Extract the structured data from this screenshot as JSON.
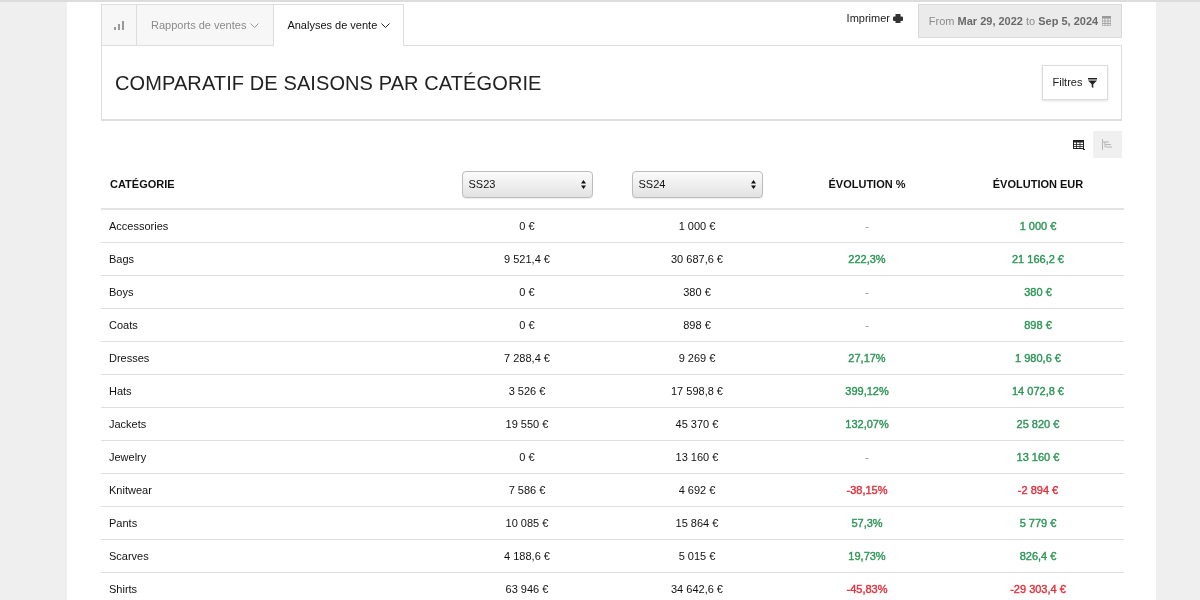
{
  "tabs": [
    {
      "kind": "icon",
      "selected": false
    },
    {
      "kind": "dropdown",
      "label": "Rapports de ventes",
      "selected": false
    },
    {
      "kind": "dropdown",
      "label": "Analyses de vente",
      "selected": true
    }
  ],
  "print": {
    "label": "Imprimer"
  },
  "date_range": {
    "text": "From **Mar 29, 2022** to **Sep 5, 2024**"
  },
  "panel": {
    "title": "COMPARATIF DE SAISONS PAR CATÉGORIE",
    "filter_button": "Filtres"
  },
  "view_toggles": [
    {
      "kind": "table",
      "selected": true
    },
    {
      "kind": "tree",
      "selected": false
    }
  ],
  "table": {
    "columns": [
      {
        "kind": "text",
        "label": "CATÉGORIE"
      },
      {
        "kind": "select",
        "value": "SS23"
      },
      {
        "kind": "select",
        "value": "SS24"
      },
      {
        "kind": "text",
        "label": "ÉVOLUTION %"
      },
      {
        "kind": "text",
        "label": "ÉVOLUTION EUR"
      }
    ],
    "rows": [
      {
        "category": "Accessories",
        "season_1": "0 €",
        "season_2": "1 000 €",
        "evolution_pct": {
          "kind": "empty",
          "text": "-"
        },
        "evolution_eur": {
          "kind": "value",
          "text": "1 000 €",
          "color": "#2f9657"
        }
      },
      {
        "category": "Bags",
        "season_1": "9 521,4 €",
        "season_2": "30 687,6 €",
        "evolution_pct": {
          "kind": "value",
          "text": "222,3%",
          "color": "#2f9657"
        },
        "evolution_eur": {
          "kind": "value",
          "text": "21 166,2 €",
          "color": "#2f9657"
        }
      },
      {
        "category": "Boys",
        "season_1": "0 €",
        "season_2": "380 €",
        "evolution_pct": {
          "kind": "empty",
          "text": "-"
        },
        "evolution_eur": {
          "kind": "value",
          "text": "380 €",
          "color": "#2f9657"
        }
      },
      {
        "category": "Coats",
        "season_1": "0 €",
        "season_2": "898 €",
        "evolution_pct": {
          "kind": "empty",
          "text": "-"
        },
        "evolution_eur": {
          "kind": "value",
          "text": "898 €",
          "color": "#2f9657"
        }
      },
      {
        "category": "Dresses",
        "season_1": "7 288,4 €",
        "season_2": "9 269 €",
        "evolution_pct": {
          "kind": "value",
          "text": "27,17%",
          "color": "#2f9657"
        },
        "evolution_eur": {
          "kind": "value",
          "text": "1 980,6 €",
          "color": "#2f9657"
        }
      },
      {
        "category": "Hats",
        "season_1": "3 526 €",
        "season_2": "17 598,8 €",
        "evolution_pct": {
          "kind": "value",
          "text": "399,12%",
          "color": "#2f9657"
        },
        "evolution_eur": {
          "kind": "value",
          "text": "14 072,8 €",
          "color": "#2f9657"
        }
      },
      {
        "category": "Jackets",
        "season_1": "19 550 €",
        "season_2": "45 370 €",
        "evolution_pct": {
          "kind": "value",
          "text": "132,07%",
          "color": "#2f9657"
        },
        "evolution_eur": {
          "kind": "value",
          "text": "25 820 €",
          "color": "#2f9657"
        }
      },
      {
        "category": "Jewelry",
        "season_1": "0 €",
        "season_2": "13 160 €",
        "evolution_pct": {
          "kind": "empty",
          "text": "-"
        },
        "evolution_eur": {
          "kind": "value",
          "text": "13 160 €",
          "color": "#2f9657"
        }
      },
      {
        "category": "Knitwear",
        "season_1": "7 586 €",
        "season_2": "4 692 €",
        "evolution_pct": {
          "kind": "value",
          "text": "-38,15%",
          "color": "#e2323c"
        },
        "evolution_eur": {
          "kind": "value",
          "text": "-2 894 €",
          "color": "#e2323c"
        }
      },
      {
        "category": "Pants",
        "season_1": "10 085 €",
        "season_2": "15 864 €",
        "evolution_pct": {
          "kind": "value",
          "text": "57,3%",
          "color": "#2f9657"
        },
        "evolution_eur": {
          "kind": "value",
          "text": "5 779 €",
          "color": "#2f9657"
        }
      },
      {
        "category": "Scarves",
        "season_1": "4 188,6 €",
        "season_2": "5 015 €",
        "evolution_pct": {
          "kind": "value",
          "text": "19,73%",
          "color": "#2f9657"
        },
        "evolution_eur": {
          "kind": "value",
          "text": "826,4 €",
          "color": "#2f9657"
        }
      },
      {
        "category": "Shirts",
        "season_1": "63 946 €",
        "season_2": "34 642,6 €",
        "evolution_pct": {
          "kind": "value",
          "text": "-45,83%",
          "color": "#e2323c"
        },
        "evolution_eur": {
          "kind": "value",
          "text": "-29 303,4 €",
          "color": "#e2323c"
        }
      }
    ]
  }
}
